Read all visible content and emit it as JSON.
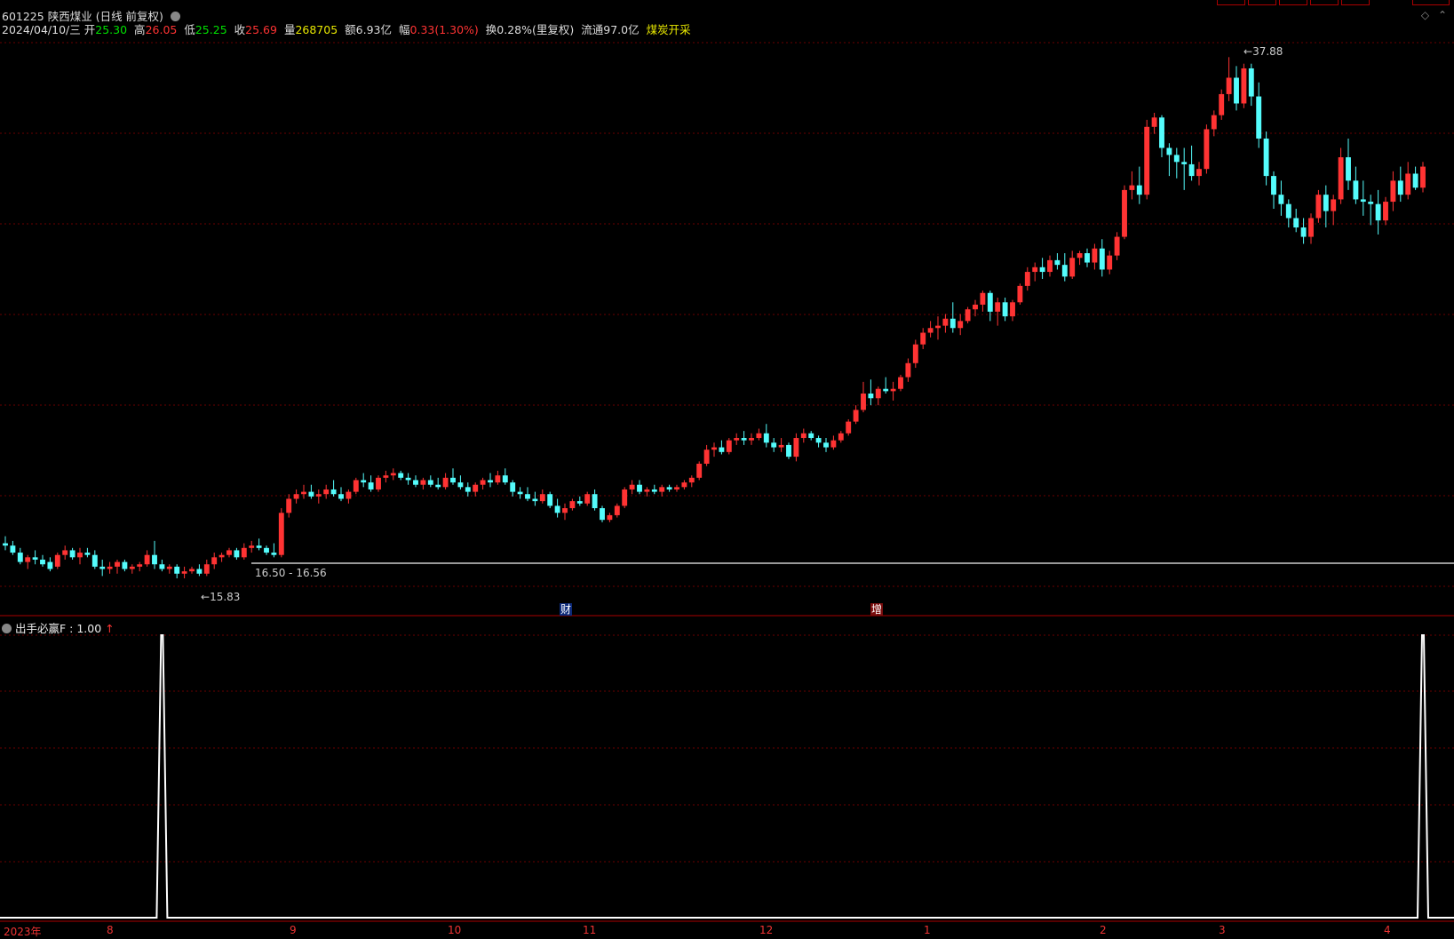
{
  "header": {
    "code": "601225",
    "name": "陕西煤业",
    "mode": "(日线 前复权)",
    "date": "2024/04/10/三",
    "open_label": "开",
    "open": "25.30",
    "high_label": "高",
    "high": "26.05",
    "low_label": "低",
    "low": "25.25",
    "close_label": "收",
    "close": "25.69",
    "vol_label": "量",
    "vol": "268705",
    "amt_label": "额",
    "amt": "6.93亿",
    "chg_label": "幅",
    "chg": "0.33(1.30%)",
    "turnover": "换0.28%(里复权)",
    "float": "流通97.0亿",
    "sector": "煤炭开采"
  },
  "colors": {
    "up": "#ff3333",
    "down": "#54fcfc",
    "grid": "#6a0000",
    "label_red": "#ff3333",
    "label_green": "#00e000",
    "label_yellow": "#e8e800",
    "indicator_line": "#ffffff"
  },
  "annotations": {
    "high_marker": "37.88",
    "low_marker": "15.83",
    "range_label": "16.50 - 16.56",
    "badge_cai": "财",
    "badge_zeng": "增"
  },
  "indicator": {
    "title": "出手必赢F",
    "value": ": 1.00",
    "arrow": "↑"
  },
  "x_axis": {
    "labels": [
      "2023年",
      "8",
      "9",
      "10",
      "11",
      "12",
      "1",
      "2",
      "3",
      "4"
    ]
  },
  "chart_data": {
    "type": "candlestick",
    "title": "",
    "ylim": [
      14.5,
      38.5
    ],
    "ohlc": [
      [
        17.1,
        17.4,
        16.8,
        17.0
      ],
      [
        17.0,
        17.2,
        16.6,
        16.7
      ],
      [
        16.7,
        16.9,
        16.2,
        16.3
      ],
      [
        16.3,
        16.6,
        16.0,
        16.5
      ],
      [
        16.5,
        16.8,
        16.2,
        16.4
      ],
      [
        16.4,
        16.6,
        16.1,
        16.2
      ],
      [
        16.3,
        16.5,
        15.9,
        16.0
      ],
      [
        16.1,
        16.7,
        16.0,
        16.6
      ],
      [
        16.6,
        17.0,
        16.4,
        16.8
      ],
      [
        16.8,
        16.9,
        16.4,
        16.5
      ],
      [
        16.5,
        16.9,
        16.2,
        16.7
      ],
      [
        16.7,
        16.9,
        16.5,
        16.6
      ],
      [
        16.6,
        16.8,
        16.0,
        16.1
      ],
      [
        16.1,
        16.4,
        15.7,
        16.0
      ],
      [
        16.0,
        16.3,
        15.8,
        16.1
      ],
      [
        16.1,
        16.4,
        15.8,
        16.3
      ],
      [
        16.3,
        16.4,
        15.9,
        16.0
      ],
      [
        16.0,
        16.2,
        15.8,
        16.1
      ],
      [
        16.1,
        16.3,
        15.9,
        16.2
      ],
      [
        16.2,
        16.8,
        16.1,
        16.6
      ],
      [
        16.6,
        17.2,
        16.0,
        16.2
      ],
      [
        16.2,
        16.4,
        15.9,
        16.0
      ],
      [
        16.0,
        16.2,
        15.8,
        16.1
      ],
      [
        16.1,
        16.2,
        15.6,
        15.8
      ],
      [
        15.8,
        16.1,
        15.6,
        15.9
      ],
      [
        15.9,
        16.1,
        15.8,
        16.0
      ],
      [
        16.0,
        16.2,
        15.7,
        15.8
      ],
      [
        15.8,
        16.4,
        15.7,
        16.2
      ],
      [
        16.2,
        16.7,
        16.0,
        16.5
      ],
      [
        16.5,
        16.7,
        16.3,
        16.6
      ],
      [
        16.6,
        16.9,
        16.5,
        16.8
      ],
      [
        16.8,
        16.9,
        16.4,
        16.5
      ],
      [
        16.5,
        17.1,
        16.4,
        16.9
      ],
      [
        16.9,
        17.2,
        16.7,
        17.0
      ],
      [
        17.0,
        17.3,
        16.8,
        16.9
      ],
      [
        16.9,
        17.0,
        16.6,
        16.7
      ],
      [
        16.7,
        17.1,
        16.5,
        16.6
      ],
      [
        16.6,
        18.6,
        16.5,
        18.4
      ],
      [
        18.4,
        19.2,
        18.2,
        19.0
      ],
      [
        19.0,
        19.4,
        18.8,
        19.2
      ],
      [
        19.2,
        19.6,
        19.0,
        19.3
      ],
      [
        19.3,
        19.6,
        19.0,
        19.1
      ],
      [
        19.1,
        19.4,
        18.8,
        19.2
      ],
      [
        19.2,
        19.6,
        19.0,
        19.4
      ],
      [
        19.4,
        19.8,
        19.1,
        19.2
      ],
      [
        19.2,
        19.5,
        18.9,
        19.0
      ],
      [
        19.0,
        19.4,
        18.8,
        19.3
      ],
      [
        19.3,
        19.9,
        19.2,
        19.8
      ],
      [
        19.8,
        20.1,
        19.5,
        19.7
      ],
      [
        19.7,
        20.0,
        19.3,
        19.4
      ],
      [
        19.4,
        20.0,
        19.3,
        19.9
      ],
      [
        19.9,
        20.2,
        19.7,
        20.0
      ],
      [
        20.0,
        20.3,
        19.8,
        20.1
      ],
      [
        20.1,
        20.2,
        19.8,
        19.9
      ],
      [
        19.9,
        20.1,
        19.6,
        19.8
      ],
      [
        19.8,
        20.0,
        19.5,
        19.6
      ],
      [
        19.6,
        19.9,
        19.4,
        19.8
      ],
      [
        19.8,
        20.0,
        19.5,
        19.6
      ],
      [
        19.6,
        19.9,
        19.4,
        19.5
      ],
      [
        19.5,
        20.1,
        19.4,
        19.9
      ],
      [
        19.9,
        20.3,
        19.6,
        19.7
      ],
      [
        19.7,
        20.0,
        19.4,
        19.5
      ],
      [
        19.5,
        19.7,
        19.1,
        19.3
      ],
      [
        19.3,
        19.7,
        19.1,
        19.6
      ],
      [
        19.6,
        19.9,
        19.4,
        19.8
      ],
      [
        19.8,
        20.1,
        19.5,
        19.7
      ],
      [
        19.7,
        20.2,
        19.6,
        20.0
      ],
      [
        20.0,
        20.3,
        19.6,
        19.7
      ],
      [
        19.7,
        19.8,
        19.1,
        19.3
      ],
      [
        19.3,
        19.5,
        19.0,
        19.2
      ],
      [
        19.2,
        19.5,
        18.9,
        19.0
      ],
      [
        19.0,
        19.3,
        18.7,
        18.9
      ],
      [
        18.9,
        19.4,
        18.8,
        19.2
      ],
      [
        19.2,
        19.3,
        18.6,
        18.7
      ],
      [
        18.7,
        19.0,
        18.2,
        18.4
      ],
      [
        18.4,
        18.8,
        18.1,
        18.6
      ],
      [
        18.6,
        19.0,
        18.5,
        18.9
      ],
      [
        18.9,
        19.1,
        18.7,
        18.8
      ],
      [
        18.8,
        19.3,
        18.7,
        19.2
      ],
      [
        19.2,
        19.4,
        18.5,
        18.6
      ],
      [
        18.6,
        18.7,
        18.0,
        18.1
      ],
      [
        18.1,
        18.4,
        18.0,
        18.3
      ],
      [
        18.3,
        18.8,
        18.2,
        18.7
      ],
      [
        18.7,
        19.5,
        18.6,
        19.4
      ],
      [
        19.4,
        19.8,
        19.2,
        19.6
      ],
      [
        19.6,
        19.8,
        19.2,
        19.3
      ],
      [
        19.3,
        19.5,
        19.1,
        19.4
      ],
      [
        19.4,
        19.6,
        19.2,
        19.3
      ],
      [
        19.3,
        19.6,
        19.1,
        19.5
      ],
      [
        19.5,
        19.6,
        19.3,
        19.4
      ],
      [
        19.4,
        19.6,
        19.3,
        19.5
      ],
      [
        19.5,
        19.8,
        19.4,
        19.7
      ],
      [
        19.7,
        20.0,
        19.5,
        19.9
      ],
      [
        19.9,
        20.6,
        19.8,
        20.5
      ],
      [
        20.5,
        21.3,
        20.4,
        21.1
      ],
      [
        21.1,
        21.4,
        20.8,
        21.2
      ],
      [
        21.2,
        21.5,
        20.9,
        21.0
      ],
      [
        21.0,
        21.6,
        20.9,
        21.5
      ],
      [
        21.5,
        21.8,
        21.3,
        21.6
      ],
      [
        21.6,
        21.9,
        21.3,
        21.5
      ],
      [
        21.5,
        21.8,
        21.3,
        21.6
      ],
      [
        21.6,
        22.0,
        21.5,
        21.8
      ],
      [
        21.8,
        22.2,
        21.2,
        21.4
      ],
      [
        21.4,
        21.6,
        21.0,
        21.2
      ],
      [
        21.2,
        21.6,
        21.0,
        21.3
      ],
      [
        21.3,
        21.4,
        20.7,
        20.8
      ],
      [
        20.8,
        21.8,
        20.6,
        21.6
      ],
      [
        21.6,
        22.0,
        21.4,
        21.8
      ],
      [
        21.8,
        21.9,
        21.5,
        21.6
      ],
      [
        21.6,
        21.7,
        21.2,
        21.4
      ],
      [
        21.4,
        21.6,
        21.0,
        21.2
      ],
      [
        21.2,
        21.7,
        21.1,
        21.5
      ],
      [
        21.5,
        21.9,
        21.4,
        21.8
      ],
      [
        21.8,
        22.4,
        21.7,
        22.3
      ],
      [
        22.3,
        23.0,
        22.2,
        22.8
      ],
      [
        22.8,
        24.0,
        22.7,
        23.5
      ],
      [
        23.5,
        24.1,
        23.0,
        23.3
      ],
      [
        23.3,
        23.8,
        23.0,
        23.7
      ],
      [
        23.7,
        24.2,
        23.5,
        23.6
      ],
      [
        23.6,
        24.0,
        23.2,
        23.7
      ],
      [
        23.7,
        24.3,
        23.6,
        24.2
      ],
      [
        24.2,
        25.0,
        24.0,
        24.8
      ],
      [
        24.8,
        25.8,
        24.6,
        25.6
      ],
      [
        25.6,
        26.3,
        25.4,
        26.1
      ],
      [
        26.1,
        26.6,
        25.9,
        26.3
      ],
      [
        26.3,
        26.8,
        25.8,
        26.4
      ],
      [
        26.4,
        26.9,
        26.1,
        26.7
      ],
      [
        26.7,
        27.4,
        26.1,
        26.3
      ],
      [
        26.3,
        26.9,
        26.0,
        26.6
      ],
      [
        26.6,
        27.2,
        26.5,
        27.1
      ],
      [
        27.1,
        27.5,
        26.8,
        27.3
      ],
      [
        27.3,
        27.9,
        27.0,
        27.8
      ],
      [
        27.8,
        27.9,
        26.6,
        27.0
      ],
      [
        27.0,
        27.6,
        26.4,
        27.4
      ],
      [
        27.4,
        27.6,
        26.6,
        26.8
      ],
      [
        26.8,
        27.5,
        26.6,
        27.4
      ],
      [
        27.4,
        28.2,
        27.3,
        28.1
      ],
      [
        28.1,
        28.9,
        27.9,
        28.7
      ],
      [
        28.7,
        29.1,
        28.3,
        28.9
      ],
      [
        28.9,
        29.3,
        28.4,
        28.7
      ],
      [
        28.7,
        29.4,
        28.5,
        29.2
      ],
      [
        29.2,
        29.5,
        28.8,
        29.0
      ],
      [
        29.0,
        29.5,
        28.3,
        28.5
      ],
      [
        28.5,
        29.6,
        28.4,
        29.3
      ],
      [
        29.3,
        29.6,
        29.0,
        29.5
      ],
      [
        29.5,
        29.7,
        28.9,
        29.1
      ],
      [
        29.1,
        29.9,
        28.8,
        29.7
      ],
      [
        29.7,
        30.1,
        28.5,
        28.8
      ],
      [
        28.8,
        29.6,
        28.6,
        29.4
      ],
      [
        29.4,
        30.4,
        29.2,
        30.2
      ],
      [
        30.2,
        32.4,
        30.1,
        32.2
      ],
      [
        32.2,
        33.0,
        31.8,
        32.4
      ],
      [
        32.4,
        33.2,
        31.6,
        32.0
      ],
      [
        32.0,
        35.2,
        31.8,
        34.9
      ],
      [
        34.9,
        35.5,
        34.6,
        35.3
      ],
      [
        35.3,
        35.4,
        33.6,
        34.0
      ],
      [
        34.0,
        34.2,
        32.8,
        33.7
      ],
      [
        33.7,
        34.0,
        32.7,
        33.4
      ],
      [
        33.4,
        34.0,
        32.2,
        33.3
      ],
      [
        33.3,
        34.1,
        32.6,
        32.8
      ],
      [
        32.8,
        33.4,
        32.4,
        33.1
      ],
      [
        33.1,
        35.0,
        32.9,
        34.8
      ],
      [
        34.8,
        35.6,
        34.5,
        35.4
      ],
      [
        35.4,
        36.5,
        35.2,
        36.3
      ],
      [
        36.3,
        37.88,
        36.0,
        37.0
      ],
      [
        37.0,
        37.5,
        35.6,
        35.9
      ],
      [
        35.9,
        37.6,
        35.7,
        37.4
      ],
      [
        37.4,
        37.6,
        35.8,
        36.2
      ],
      [
        36.2,
        36.8,
        34.0,
        34.4
      ],
      [
        34.4,
        34.7,
        32.4,
        32.8
      ],
      [
        32.8,
        33.0,
        31.4,
        32.0
      ],
      [
        32.0,
        32.6,
        31.1,
        31.6
      ],
      [
        31.6,
        31.8,
        30.6,
        31.0
      ],
      [
        31.0,
        31.4,
        30.4,
        30.6
      ],
      [
        30.6,
        31.0,
        29.9,
        30.2
      ],
      [
        30.2,
        31.2,
        29.9,
        31.0
      ],
      [
        31.0,
        32.2,
        30.8,
        32.0
      ],
      [
        32.0,
        32.4,
        30.6,
        31.3
      ],
      [
        31.3,
        32.0,
        30.7,
        31.8
      ],
      [
        31.8,
        34.0,
        31.6,
        33.6
      ],
      [
        33.6,
        34.4,
        32.2,
        32.6
      ],
      [
        32.6,
        33.2,
        31.6,
        31.8
      ],
      [
        31.8,
        32.6,
        31.1,
        31.7
      ],
      [
        31.7,
        32.0,
        30.7,
        31.6
      ],
      [
        31.6,
        32.2,
        30.3,
        30.9
      ],
      [
        30.9,
        31.9,
        30.7,
        31.7
      ],
      [
        31.7,
        33.0,
        31.3,
        32.6
      ],
      [
        32.6,
        33.2,
        31.7,
        32.0
      ],
      [
        32.0,
        33.4,
        31.8,
        32.9
      ],
      [
        32.9,
        33.2,
        32.2,
        32.3
      ],
      [
        32.3,
        33.4,
        32.1,
        33.2
      ]
    ],
    "indicator_values": [
      0,
      0,
      0,
      0,
      0,
      0,
      0,
      0,
      0,
      0,
      0,
      0,
      0,
      0,
      0,
      0,
      0,
      0,
      0,
      0,
      0,
      0,
      0,
      0,
      0,
      0,
      0,
      0,
      0,
      0,
      0,
      0,
      0,
      0,
      0,
      0,
      0,
      0,
      0,
      0,
      0,
      0,
      0,
      0,
      0,
      0,
      0,
      0,
      0,
      0,
      0,
      0,
      0,
      0,
      0,
      0,
      0,
      0,
      0,
      0,
      0,
      0,
      0,
      0,
      0,
      0,
      0,
      0,
      0,
      0,
      0,
      0,
      0,
      0,
      0,
      0,
      0,
      0,
      0,
      0,
      0,
      0,
      0,
      0,
      0,
      0,
      0,
      0,
      0,
      0,
      0,
      0,
      0,
      0,
      0,
      0,
      0,
      0,
      0,
      0,
      0,
      0,
      0,
      0,
      0,
      0,
      0,
      0,
      0,
      0,
      0,
      0,
      0,
      0,
      0,
      0,
      0,
      0,
      0,
      0,
      0,
      0,
      0,
      0,
      0,
      0,
      0,
      0,
      0,
      0,
      0,
      0,
      0,
      0,
      0,
      0,
      0,
      0,
      0,
      0,
      0,
      0,
      0,
      0,
      0,
      0,
      0,
      0,
      0,
      0,
      0,
      0,
      0,
      0,
      0,
      0,
      0,
      0,
      0,
      0,
      0,
      0,
      0,
      0,
      0,
      0,
      0,
      0,
      0,
      0,
      0,
      0,
      0,
      0,
      0,
      0,
      0,
      0,
      0,
      0,
      0,
      0,
      0,
      0,
      0,
      0,
      0,
      0,
      0,
      0,
      0,
      0,
      0,
      0,
      0,
      0,
      0,
      0,
      0,
      0,
      0,
      0,
      0,
      0,
      0,
      0,
      0,
      0,
      0,
      1
    ],
    "indicator_spikes": [
      21,
      190
    ]
  }
}
